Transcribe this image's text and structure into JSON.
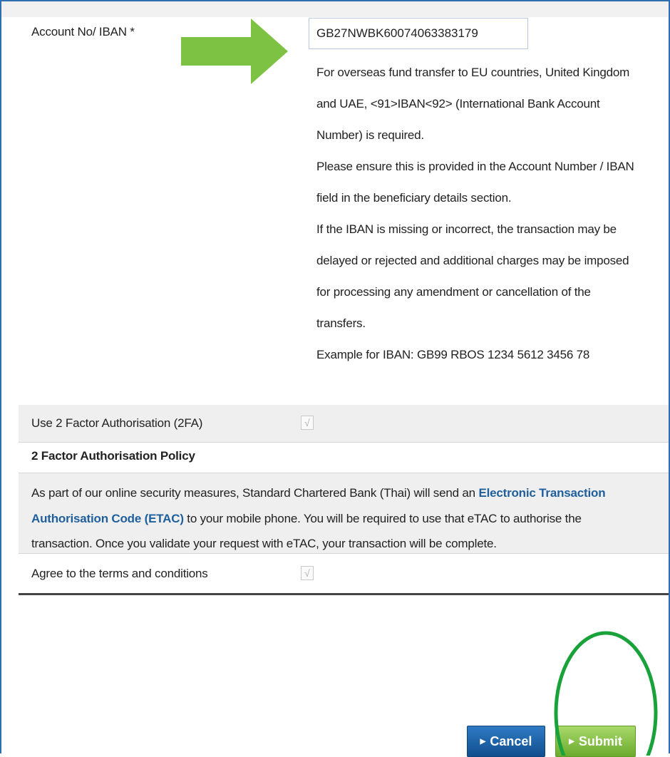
{
  "account": {
    "label": "Account No/ IBAN *",
    "value": "GB27NWBK60074063383179",
    "notes": [
      "For overseas fund transfer to EU countries, United Kingdom",
      "and UAE, <91>IBAN<92> (International Bank Account",
      "Number) is required.",
      "Please ensure this is provided in the Account Number / IBAN",
      "field in the beneficiary details section.",
      "If the IBAN is missing or incorrect, the transaction may be",
      "delayed or rejected and additional charges may be imposed",
      "for processing any amendment or cancellation of the",
      "transfers.",
      "Example for IBAN: GB99 RBOS 1234 5612 3456 78"
    ]
  },
  "two_fa": {
    "label": "Use 2 Factor Authorisation (2FA)",
    "checked": true,
    "check_glyph": "√"
  },
  "policy": {
    "heading": "2 Factor Authorisation Policy",
    "line1_pre": "As part of our online security measures, Standard Chartered Bank (Thai) will send an ",
    "line1_link": "Electronic Transaction",
    "line2_link": "Authorisation Code (ETAC)",
    "line2_post": " to your mobile phone. You will be required to use that eTAC to authorise the",
    "line3": "transaction. Once you validate your request with eTAC, your transaction will be complete."
  },
  "terms": {
    "label": "Agree to the terms and conditions",
    "checked": true,
    "check_glyph": "√"
  },
  "actions": {
    "cancel_label": "Cancel",
    "submit_label": "Submit",
    "caret": "▶"
  },
  "colors": {
    "frame_border": "#2f6fb0",
    "link": "#1f5f9c",
    "cancel_button": "#1a5c9e",
    "submit_button": "#8cc34a",
    "arrow": "#7dc242",
    "circle": "#1aa23a"
  }
}
